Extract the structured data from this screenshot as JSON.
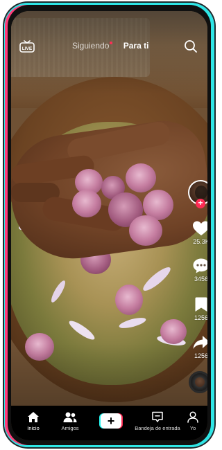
{
  "header": {
    "live_label": "LIVE",
    "tab_following": "Siguiendo",
    "tab_for_you": "Para ti",
    "icons": {
      "live": "live-tv-icon",
      "search": "search-icon"
    }
  },
  "rail": {
    "likes": "25.3K",
    "comments": "3456",
    "bookmarks": "1256",
    "shares": "1256",
    "follow_symbol": "+",
    "icons": {
      "like": "heart-icon",
      "comment": "comment-icon",
      "bookmark": "bookmark-icon",
      "share": "share-icon"
    }
  },
  "nav": {
    "items": [
      {
        "label": "Inicio",
        "icon": "home-icon"
      },
      {
        "label": "Amigos",
        "icon": "friends-icon"
      },
      {
        "label": "",
        "icon": "create-plus-icon"
      },
      {
        "label": "Bandeja de entrada",
        "icon": "inbox-icon"
      },
      {
        "label": "Yo",
        "icon": "profile-icon"
      }
    ],
    "create_symbol": "+"
  },
  "colors": {
    "accent_red": "#fe2c55",
    "accent_cyan": "#25f4ee",
    "nav_bg": "#000000"
  }
}
